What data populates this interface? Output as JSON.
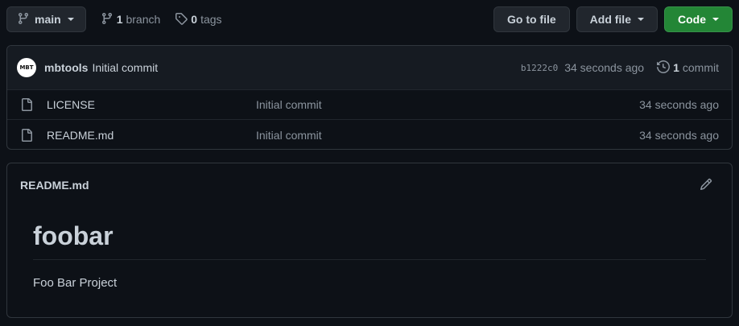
{
  "toolbar": {
    "branch_name": "main",
    "branch_count": "1",
    "branch_label": "branch",
    "tag_count": "0",
    "tag_label": "tags",
    "goto_file_label": "Go to file",
    "add_file_label": "Add file",
    "code_label": "Code"
  },
  "latest_commit": {
    "avatar_text": "MBT",
    "author": "mbtools",
    "message": "Initial commit",
    "sha": "b1222c0",
    "time": "34 seconds ago",
    "commit_count": "1",
    "commit_label": "commit"
  },
  "files": [
    {
      "name": "LICENSE",
      "commit": "Initial commit",
      "age": "34 seconds ago"
    },
    {
      "name": "README.md",
      "commit": "Initial commit",
      "age": "34 seconds ago"
    }
  ],
  "readme": {
    "filename": "README.md",
    "heading": "foobar",
    "paragraph": "Foo Bar Project"
  },
  "colors": {
    "background": "#0d1117",
    "surface": "#161b22",
    "border": "#30363d",
    "accent_green": "#238636",
    "muted_text": "#8b949e"
  },
  "icons": [
    "branch-icon",
    "git-branch-icon",
    "tag-icon",
    "history-icon",
    "file-icon",
    "pencil-icon"
  ]
}
